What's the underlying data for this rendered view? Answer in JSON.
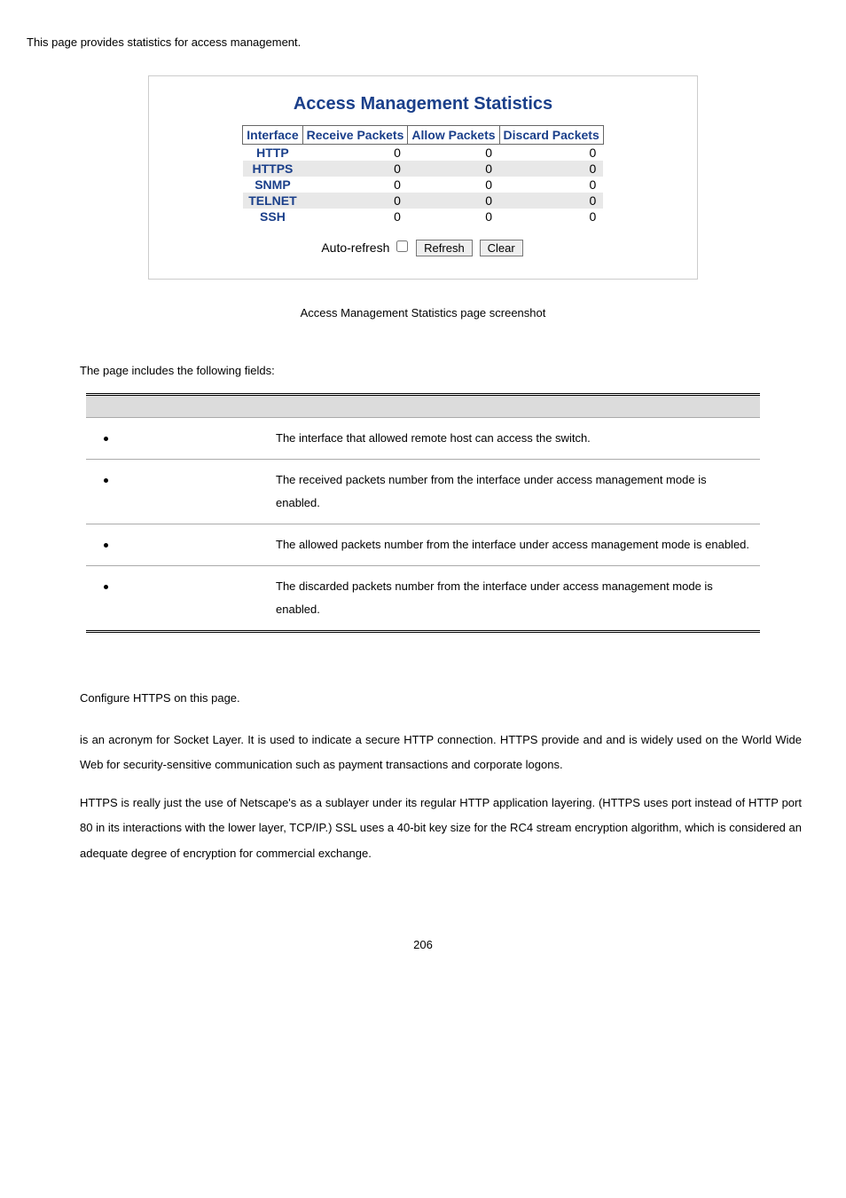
{
  "intro": "This page provides statistics for access management.",
  "figure": {
    "title": "Access Management Statistics",
    "headers": [
      "Interface",
      "Receive Packets",
      "Allow Packets",
      "Discard Packets"
    ],
    "rows": [
      {
        "iface": "HTTP",
        "recv": "0",
        "allow": "0",
        "disc": "0"
      },
      {
        "iface": "HTTPS",
        "recv": "0",
        "allow": "0",
        "disc": "0"
      },
      {
        "iface": "SNMP",
        "recv": "0",
        "allow": "0",
        "disc": "0"
      },
      {
        "iface": "TELNET",
        "recv": "0",
        "allow": "0",
        "disc": "0"
      },
      {
        "iface": "SSH",
        "recv": "0",
        "allow": "0",
        "disc": "0"
      }
    ],
    "auto_refresh_label": "Auto-refresh",
    "refresh_label": "Refresh",
    "clear_label": "Clear"
  },
  "caption": "Access Management Statistics page screenshot",
  "fields_intro": "The page includes the following fields:",
  "fields": [
    {
      "desc": "The interface that allowed remote host can access the switch."
    },
    {
      "desc": "The received packets number from the interface under access management mode is enabled."
    },
    {
      "desc": "The allowed packets number from the interface under access management mode is enabled."
    },
    {
      "desc": "The discarded packets number from the interface under access management mode is enabled."
    }
  ],
  "https_intro": "Configure HTTPS on this page.",
  "https_para1": {
    "t1": " is an acronym for ",
    "t2": " Socket Layer. It is used to indicate a secure HTTP connection. HTTPS provide ",
    "t3": " and ",
    "t4": " and is widely used on the World Wide Web for security-sensitive communication such as payment transactions and corporate logons."
  },
  "https_para2": {
    "t1": "HTTPS is really just the use of Netscape's ",
    "t2": " as a sublayer under its regular HTTP application layering. (HTTPS uses port ",
    "t3": " instead of HTTP port 80 in its interactions with the lower layer, TCP/IP.) SSL uses a 40-bit key size for the RC4 stream encryption algorithm, which is considered an adequate degree of encryption for commercial exchange."
  },
  "page_number": "206"
}
